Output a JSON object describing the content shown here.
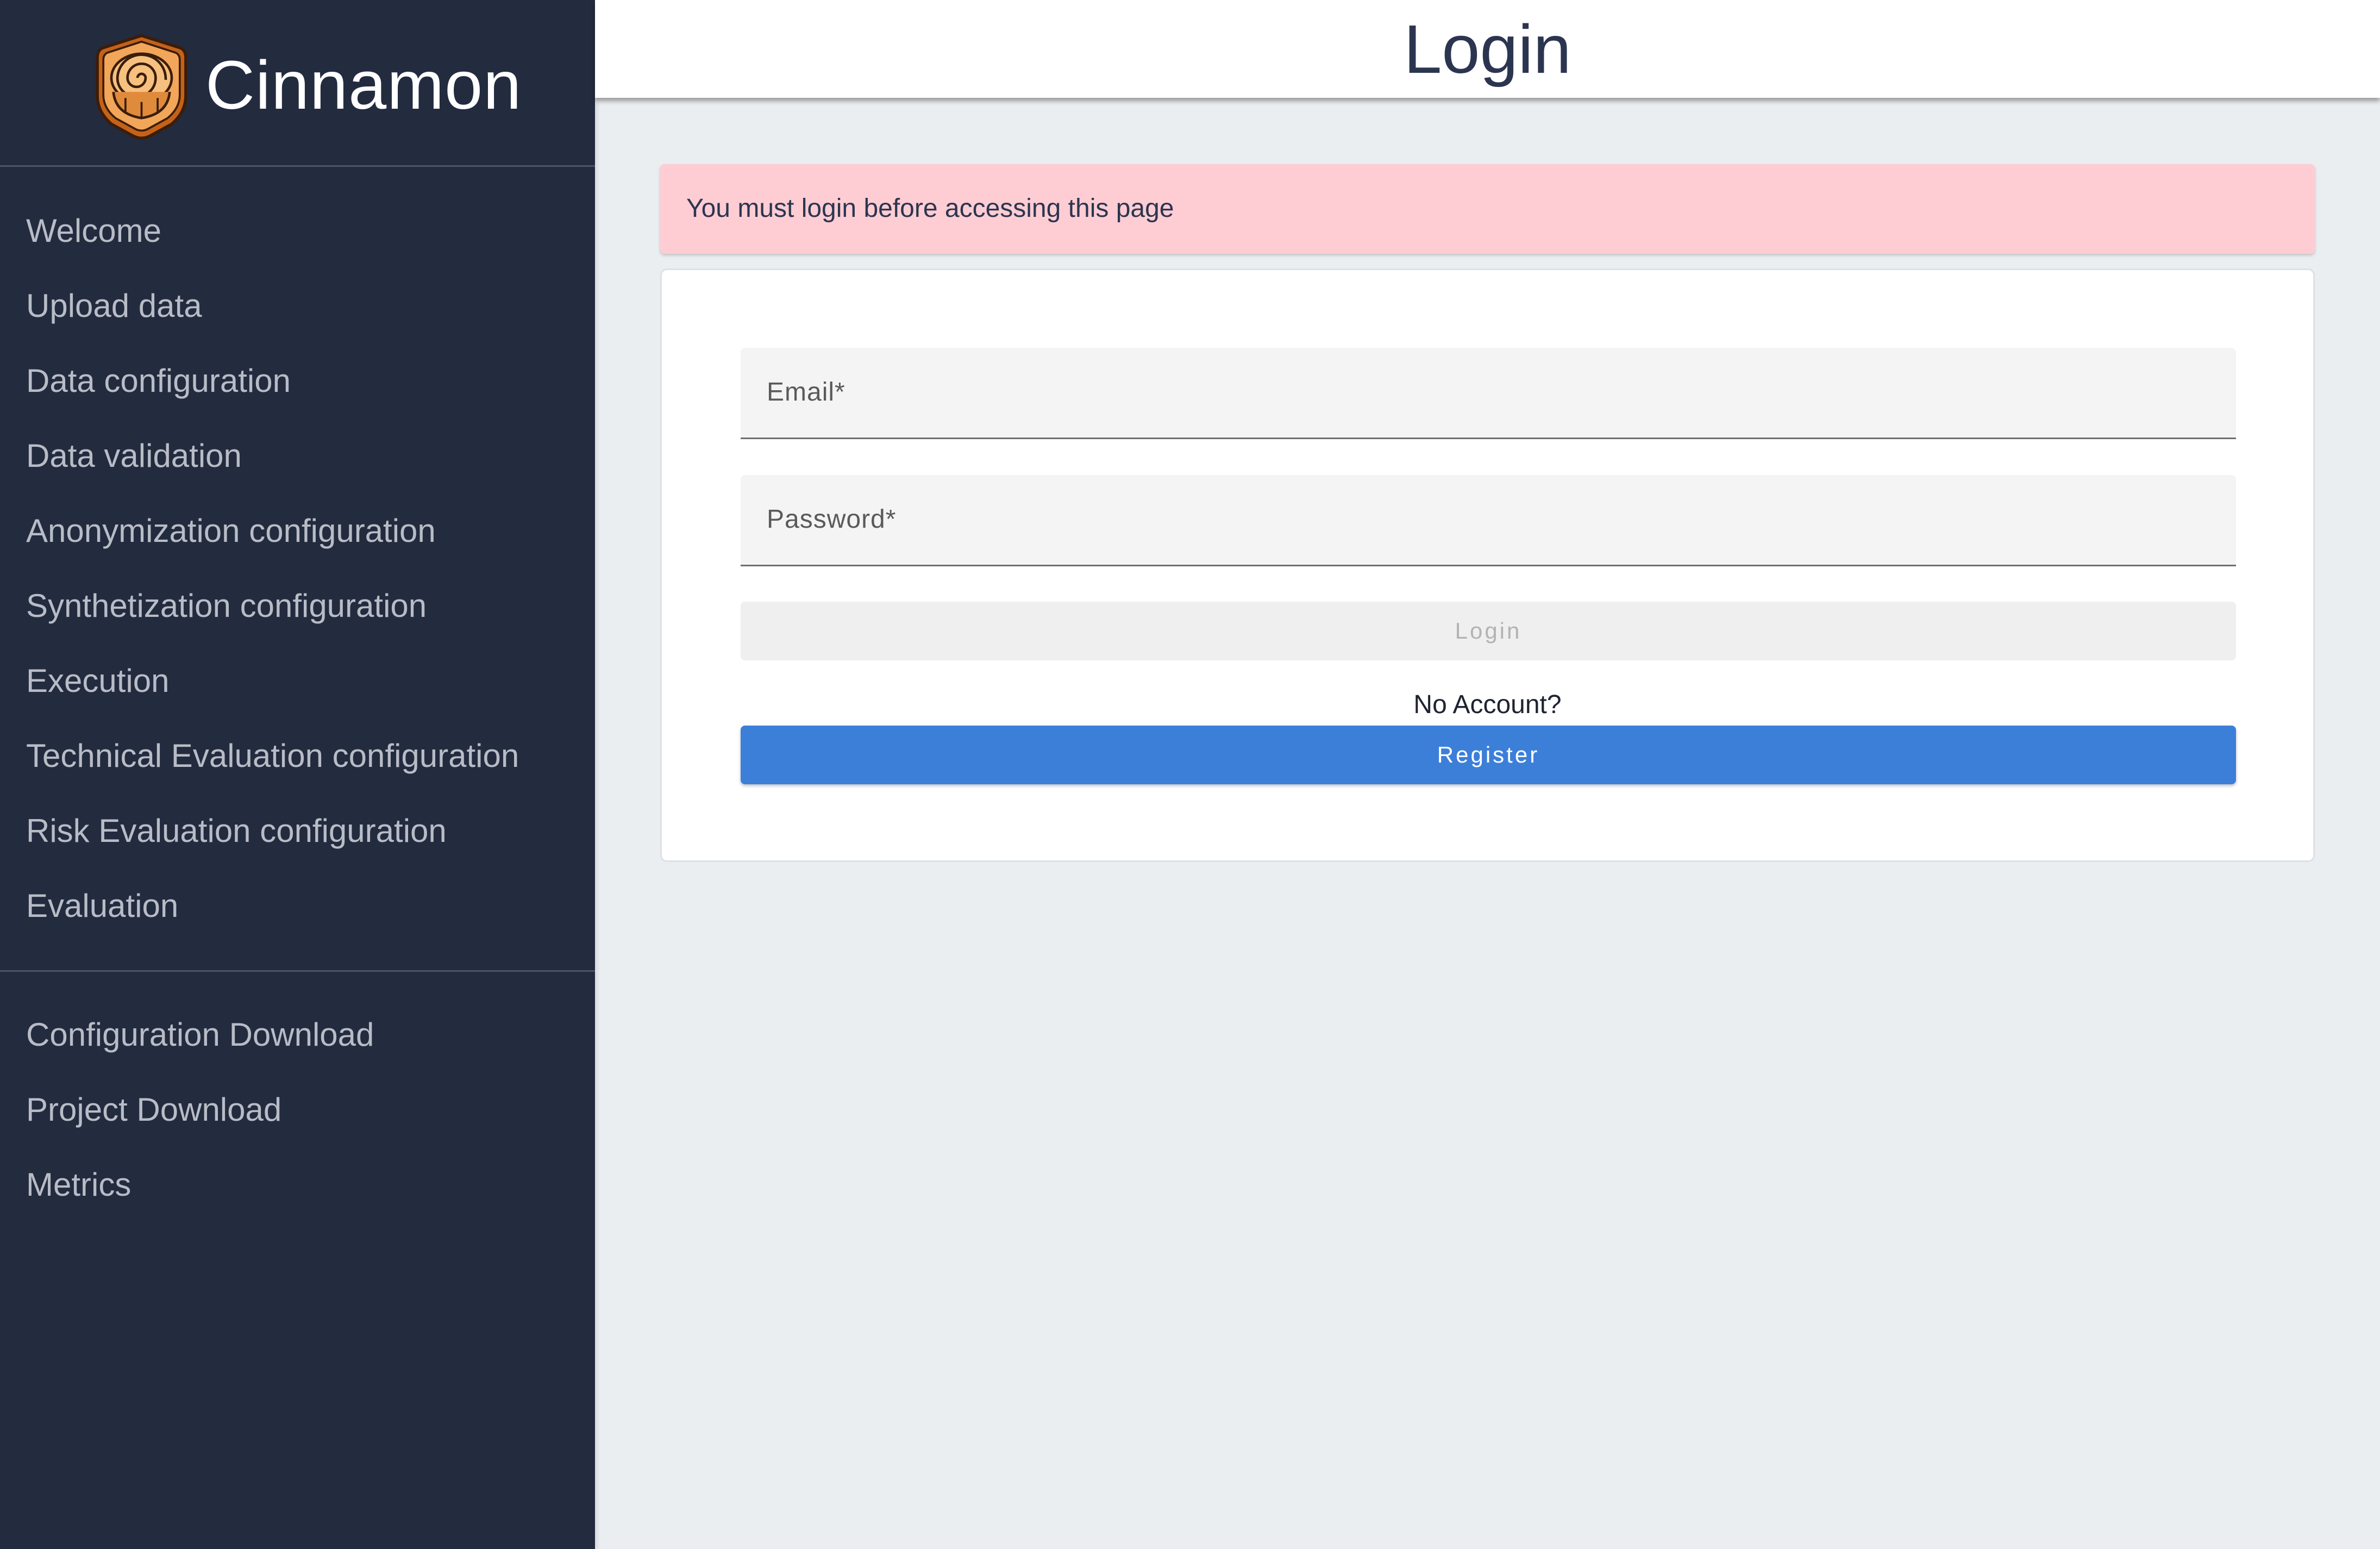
{
  "sidebar": {
    "brand": {
      "name": "Cinnamon",
      "logo_icon": "cinnamon-roll-logo"
    },
    "nav_items": [
      {
        "label": "Welcome"
      },
      {
        "label": "Upload data"
      },
      {
        "label": "Data configuration"
      },
      {
        "label": "Data validation"
      },
      {
        "label": "Anonymization configuration"
      },
      {
        "label": "Synthetization configuration"
      },
      {
        "label": "Execution"
      },
      {
        "label": "Technical Evaluation configuration"
      },
      {
        "label": "Risk Evaluation configuration"
      },
      {
        "label": "Evaluation"
      }
    ],
    "secondary_items": [
      {
        "label": "Configuration Download"
      },
      {
        "label": "Project Download"
      },
      {
        "label": "Metrics"
      }
    ]
  },
  "header": {
    "title": "Login"
  },
  "alert": {
    "message": "You must login before accessing this page"
  },
  "form": {
    "email_label": "Email*",
    "password_label": "Password*",
    "login_button": "Login",
    "no_account_text": "No Account?",
    "register_button": "Register"
  },
  "colors": {
    "sidebar_bg": "#232b3f",
    "nav_text": "#b8bcc6",
    "alert_bg": "#fecdd3",
    "primary": "#3c7fd9",
    "title_text": "#2c3550"
  }
}
